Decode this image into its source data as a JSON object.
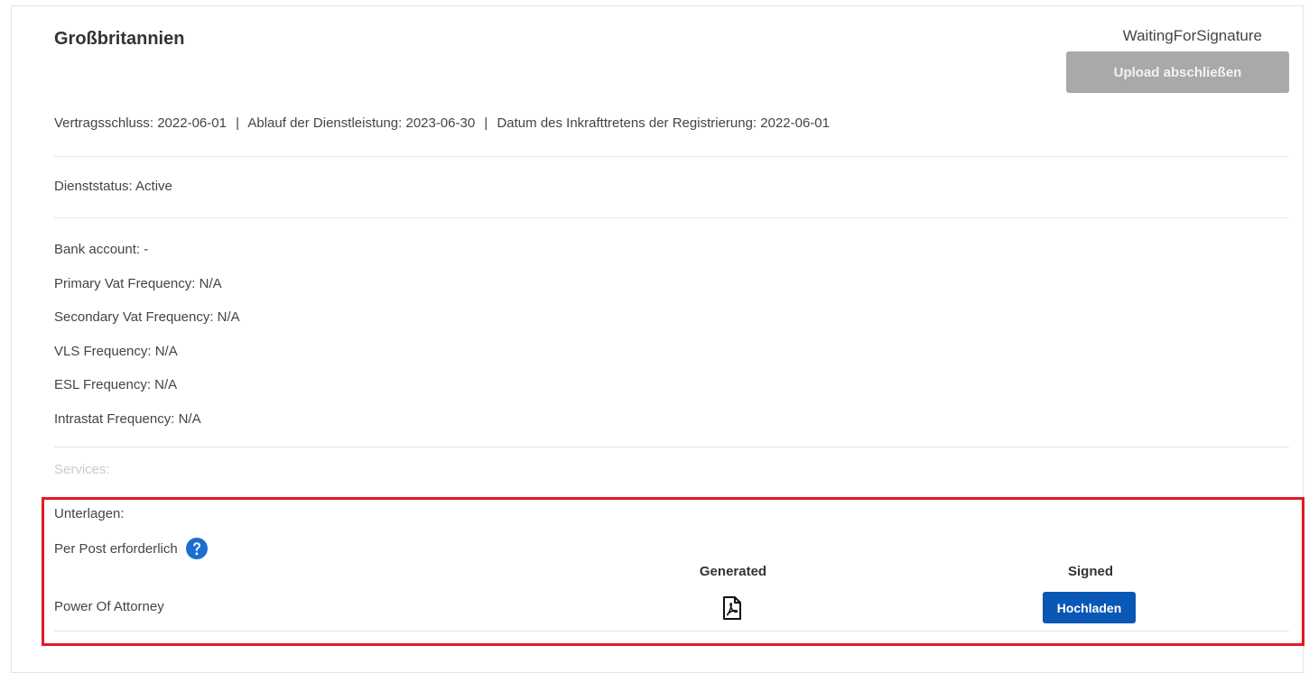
{
  "header": {
    "country": "Großbritannien",
    "status": "WaitingForSignature",
    "upload_finish_label": "Upload abschließen"
  },
  "dates": {
    "contract_conclusion": "Vertragsschluss: 2022-06-01",
    "service_expiry": "Ablauf der Dienstleistung: 2023-06-30",
    "registration_effective": "Datum des Inkrafttretens der Registrierung: 2022-06-01",
    "separator": "|"
  },
  "service_status": "Dienststatus: Active",
  "details": [
    "Bank account: -",
    "Primary Vat Frequency: N/A",
    "Secondary Vat Frequency: N/A",
    "VLS Frequency: N/A",
    "ESL Frequency: N/A",
    "Intrastat Frequency: N/A"
  ],
  "services_label": "Services:",
  "documents": {
    "label": "Unterlagen:",
    "post_required": "Per Post erforderlich",
    "help_icon": "question-circle-icon",
    "columns": {
      "generated": "Generated",
      "signed": "Signed"
    },
    "rows": [
      {
        "name": "Power Of Attorney",
        "generated_icon": "pdf-file-icon",
        "signed_action": "Hochladen"
      }
    ]
  },
  "colors": {
    "primary_button": "#0a58b5",
    "disabled_button": "#a9a9a9",
    "highlight_border": "#e31b23",
    "help_icon": "#1a6fd1"
  }
}
